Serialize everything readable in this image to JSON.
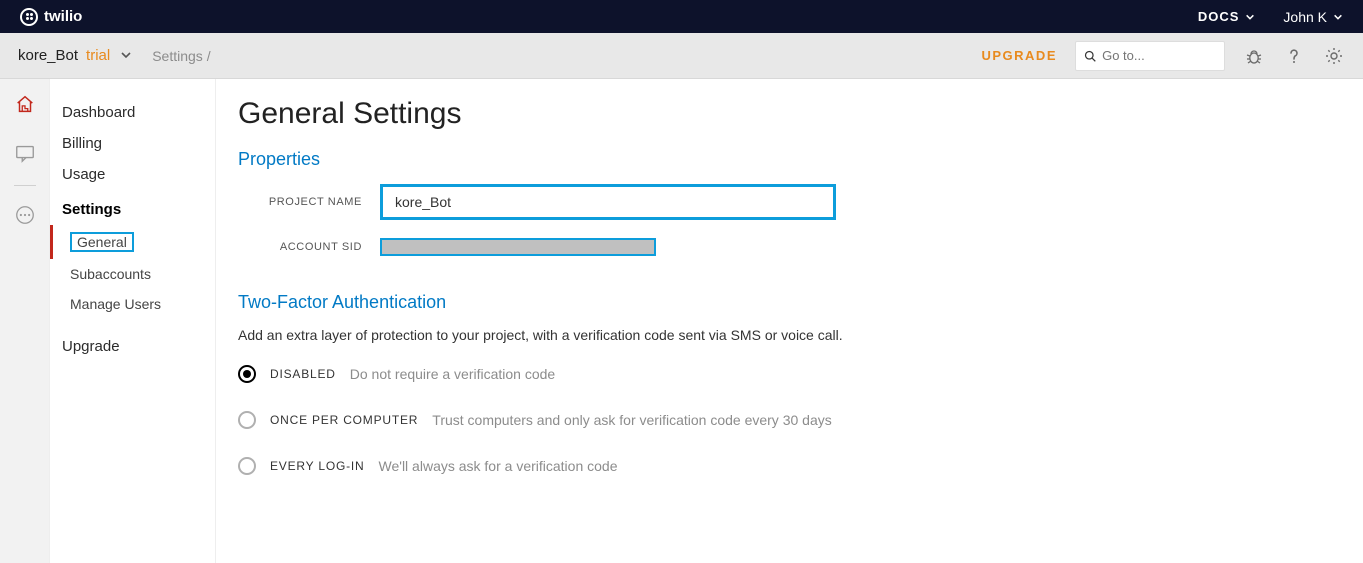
{
  "topbar": {
    "brand": "twilio",
    "docs_label": "DOCS",
    "user_name": "John K"
  },
  "subbar": {
    "project_name": "kore_Bot",
    "trial_label": "trial",
    "breadcrumb": "Settings  /",
    "upgrade_label": "UPGRADE",
    "search_placeholder": "Go to..."
  },
  "sidebar": {
    "items": [
      {
        "label": "Dashboard"
      },
      {
        "label": "Billing"
      },
      {
        "label": "Usage"
      }
    ],
    "section_label": "Settings",
    "sub_items": [
      {
        "label": "General",
        "active": true
      },
      {
        "label": "Subaccounts"
      },
      {
        "label": "Manage Users"
      }
    ],
    "upgrade_label": "Upgrade"
  },
  "main": {
    "page_title": "General Settings",
    "properties": {
      "heading": "Properties",
      "project_name_label": "PROJECT NAME",
      "project_name_value": "kore_Bot",
      "account_sid_label": "ACCOUNT SID"
    },
    "twofa": {
      "heading": "Two-Factor Authentication",
      "description": "Add an extra layer of protection to your project, with a verification code sent via SMS or voice call.",
      "options": [
        {
          "label": "DISABLED",
          "help": "Do not require a verification code",
          "selected": true
        },
        {
          "label": "ONCE PER COMPUTER",
          "help": "Trust computers and only ask for verification code every 30 days",
          "selected": false
        },
        {
          "label": "EVERY LOG-IN",
          "help": "We'll always ask for a verification code",
          "selected": false
        }
      ]
    }
  }
}
